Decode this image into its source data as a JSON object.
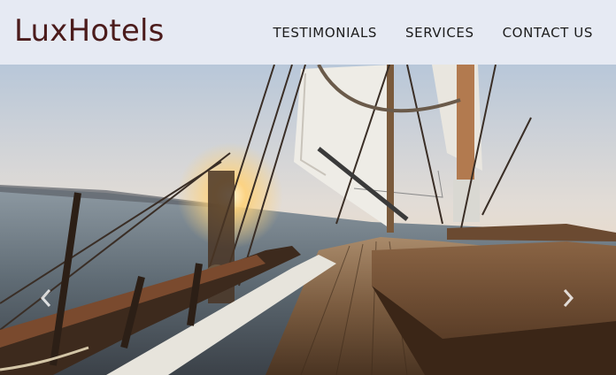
{
  "brand": {
    "name": "LuxHotels"
  },
  "nav": {
    "items": [
      {
        "label": "TESTIMONIALS"
      },
      {
        "label": "SERVICES"
      },
      {
        "label": "CONTACT US"
      }
    ]
  },
  "carousel": {
    "prev_icon": "chevron-left-icon",
    "next_icon": "chevron-right-icon"
  },
  "colors": {
    "navbar_bg": "#e6eaf3",
    "brand": "#4b1b1b",
    "nav_text": "#1c1c1c"
  }
}
